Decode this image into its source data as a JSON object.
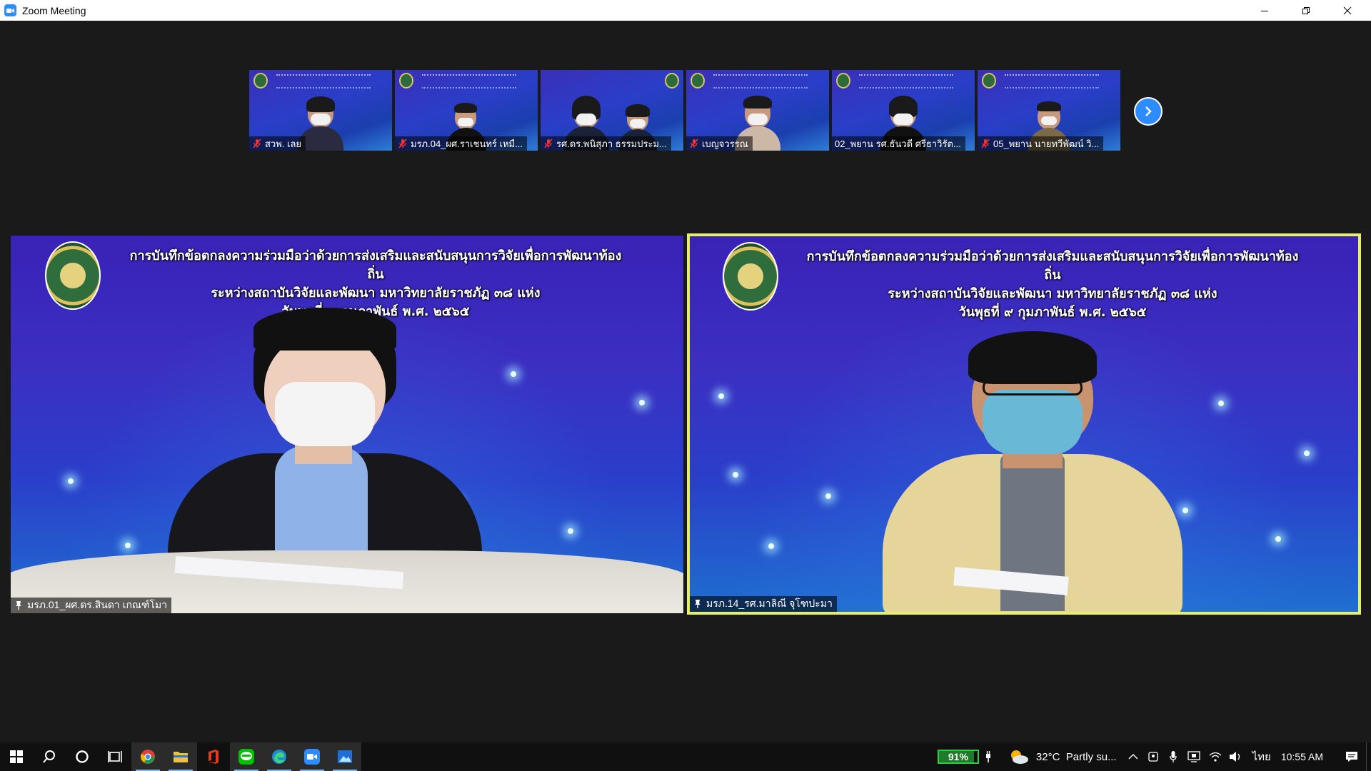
{
  "window": {
    "title": "Zoom Meeting"
  },
  "gallery": {
    "thumbnails": [
      {
        "name": "สวพ. เลย"
      },
      {
        "name": "มรภ.04_ผศ.ราเชนทร์ เหมื..."
      },
      {
        "name": "รศ.ดร.พนิสุภา ธรรมประม..."
      },
      {
        "name": "เบญจวรรณ"
      },
      {
        "name": "02_พยาน รศ.ธันวดี ศรีธาวิรัต..."
      },
      {
        "name": "05_พยาน นายทวีพัฒน์ วิ..."
      }
    ],
    "next_icon": "chevron-right-icon"
  },
  "banner": {
    "line1": "การบันทึกข้อตกลงความร่วมมือว่าด้วยการส่งเสริมและสนับสนุนการวิจัยเพื่อการพัฒนาท้องถิ่น",
    "line2": "ระหว่างสถาบันวิจัยและพัฒนา มหาวิทยาลัยราชภัฏ ๓๘ แห่ง",
    "line3": "วันพุธที่ ๙ กุมภาพันธ์ พ.ศ. ๒๕๖๕"
  },
  "speakers": {
    "left": {
      "name": "มรภ.01_ผศ.ดร.สินดา เกณฑ์โมา"
    },
    "right": {
      "name": "มรภ.14_รศ.มาลิณี จุโฑปะมา"
    }
  },
  "taskbar": {
    "battery": "91%",
    "weather": "32°C  Partly su...",
    "language": "ไทย",
    "time": "10:55 AM"
  },
  "colors": {
    "zoom_blue": "#2d8cff",
    "active_speaker_border": "#e8f06a",
    "battery_green": "#2ecc40"
  }
}
